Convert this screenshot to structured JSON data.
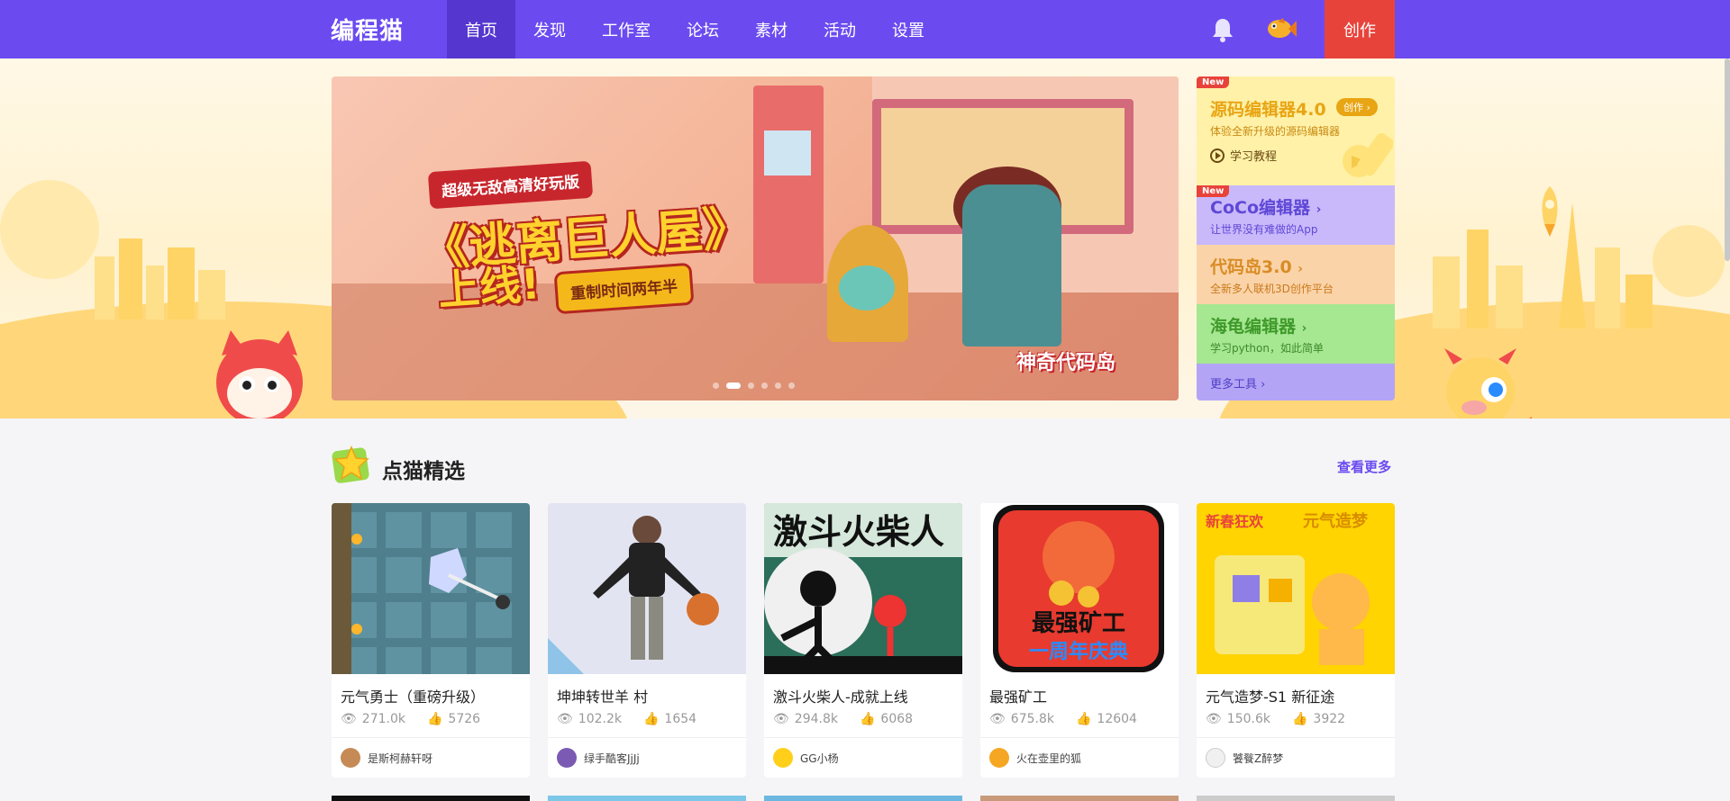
{
  "header": {
    "logo": "编程猫",
    "nav": [
      "首页",
      "发现",
      "工作室",
      "论坛",
      "素材",
      "活动",
      "设置"
    ],
    "active_index": 0,
    "create_label": "创作"
  },
  "banner": {
    "tag1": "超级无敌高清好玩版",
    "title": "《逃离巨人屋》",
    "title2": "上线!",
    "tag2": "重制时间两年半",
    "brand": "神奇代码岛",
    "slide_count": 6,
    "active_slide": 1
  },
  "tools": [
    {
      "name": "源码编辑器4.0",
      "desc": "体验全新升级的源码编辑器",
      "badge": "New",
      "chip": "创作",
      "learn": "学习教程"
    },
    {
      "name": "CoCo编辑器",
      "desc": "让世界没有难做的App",
      "badge": "New"
    },
    {
      "name": "代码岛3.0",
      "desc": "全新多人联机3D创作平台"
    },
    {
      "name": "海龟编辑器",
      "desc": "学习python，如此简单"
    },
    {
      "name": "更多工具"
    }
  ],
  "featured": {
    "title": "点猫精选",
    "see_more": "查看更多",
    "cards": [
      {
        "title": "元气勇士（重磅升级）",
        "views": "271.0k",
        "likes": "5726",
        "author": "是斯柯赫轩呀"
      },
      {
        "title": "坤坤转世羊 村",
        "views": "102.2k",
        "likes": "1654",
        "author": "绿手酷客JjJj"
      },
      {
        "title": "激斗火柴人-成就上线",
        "views": "294.8k",
        "likes": "6068",
        "author": "GG小杨"
      },
      {
        "title": "最强矿工",
        "views": "675.8k",
        "likes": "12604",
        "author": "火在壶里的狐"
      },
      {
        "title": "元气造梦-S1 新征途",
        "views": "150.6k",
        "likes": "3922",
        "author": "饕餮Z醉梦"
      }
    ]
  },
  "thumb_text": {
    "card3": "激斗火柴人",
    "card4_line1": "最强矿工",
    "card4_line2": "一周年庆典",
    "card5_line1": "元气造梦",
    "card5_line2": "新春狂欢"
  },
  "colors": {
    "nav_bg": "#6b4bf0",
    "nav_active": "#5537cf",
    "create_bg": "#e8433b",
    "accent": "#6b4bf0"
  }
}
